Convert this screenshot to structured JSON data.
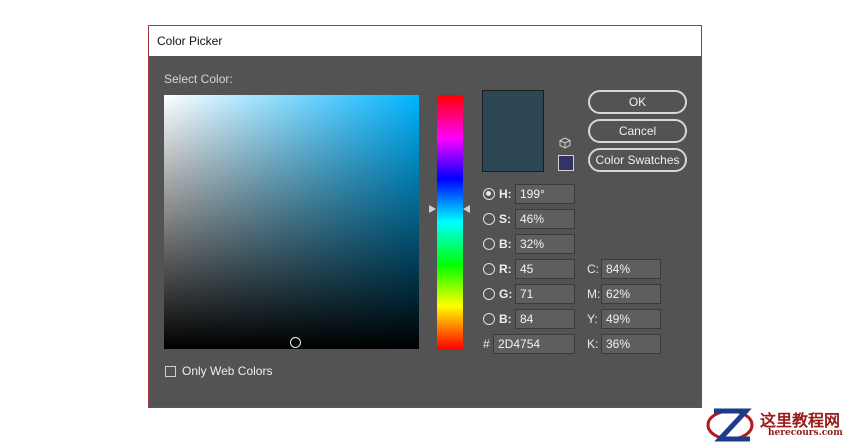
{
  "window": {
    "title": "Color Picker"
  },
  "picker": {
    "select_label": "Select Color:",
    "current_color": "#2D4754",
    "hue_color": "#00b4ff"
  },
  "buttons": {
    "ok": "OK",
    "cancel": "Cancel",
    "swatches": "Color Swatches"
  },
  "fields": {
    "hsb": [
      {
        "label": "H:",
        "value": "199°",
        "selected": true
      },
      {
        "label": "S:",
        "value": "46%",
        "selected": false
      },
      {
        "label": "B:",
        "value": "32%",
        "selected": false
      }
    ],
    "rgb": [
      {
        "label": "R:",
        "value": "45"
      },
      {
        "label": "G:",
        "value": "71"
      },
      {
        "label": "B:",
        "value": "84"
      }
    ],
    "cmyk": [
      {
        "label": "C:",
        "value": "84%"
      },
      {
        "label": "M:",
        "value": "62%"
      },
      {
        "label": "Y:",
        "value": "49%"
      },
      {
        "label": "K:",
        "value": "36%"
      }
    ],
    "hex": {
      "label": "#",
      "value": "2D4754"
    }
  },
  "options": {
    "only_web_colors": "Only Web Colors"
  },
  "watermark": {
    "title": "这里教程网",
    "url": "herecours.com"
  }
}
